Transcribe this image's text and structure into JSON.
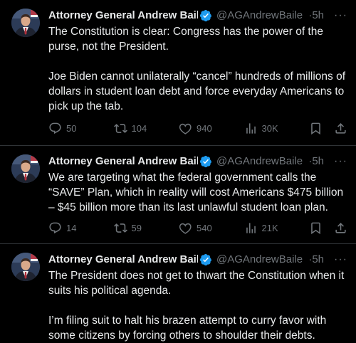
{
  "tweets": [
    {
      "author_name": "Attorney General Andrew Baile",
      "handle": "@AGAndrewBaile",
      "dot": "·",
      "time": "5h",
      "more": "···",
      "text": "The Constitution is clear: Congress has the power of the purse, not the President.\n\nJoe Biden cannot unilaterally “cancel” hundreds of millions of dollars in student loan debt and force everyday Americans to pick up the tab.",
      "replies": "50",
      "retweets": "104",
      "likes": "940",
      "views": "30K"
    },
    {
      "author_name": "Attorney General Andrew Baile",
      "handle": "@AGAndrewBaile",
      "dot": "·",
      "time": "5h",
      "more": "···",
      "text": "We are targeting what the federal government calls the “SAVE” Plan, which in reality will cost Americans $475 billion – $45 billion more than its last unlawful student loan plan.",
      "replies": "14",
      "retweets": "59",
      "likes": "540",
      "views": "21K"
    },
    {
      "author_name": "Attorney General Andrew Baile",
      "handle": "@AGAndrewBaile",
      "dot": "·",
      "time": "5h",
      "more": "···",
      "text": "The President does not get to thwart the Constitution when it suits his political agenda.\n\nI’m filing suit to halt his brazen attempt to curry favor with some citizens by forcing others to shoulder their debts."
    }
  ],
  "colors": {
    "background": "#000000",
    "text": "#e7e9ea",
    "muted": "#71767b",
    "verified": "#1d9bf0",
    "divider": "#2f3336"
  }
}
